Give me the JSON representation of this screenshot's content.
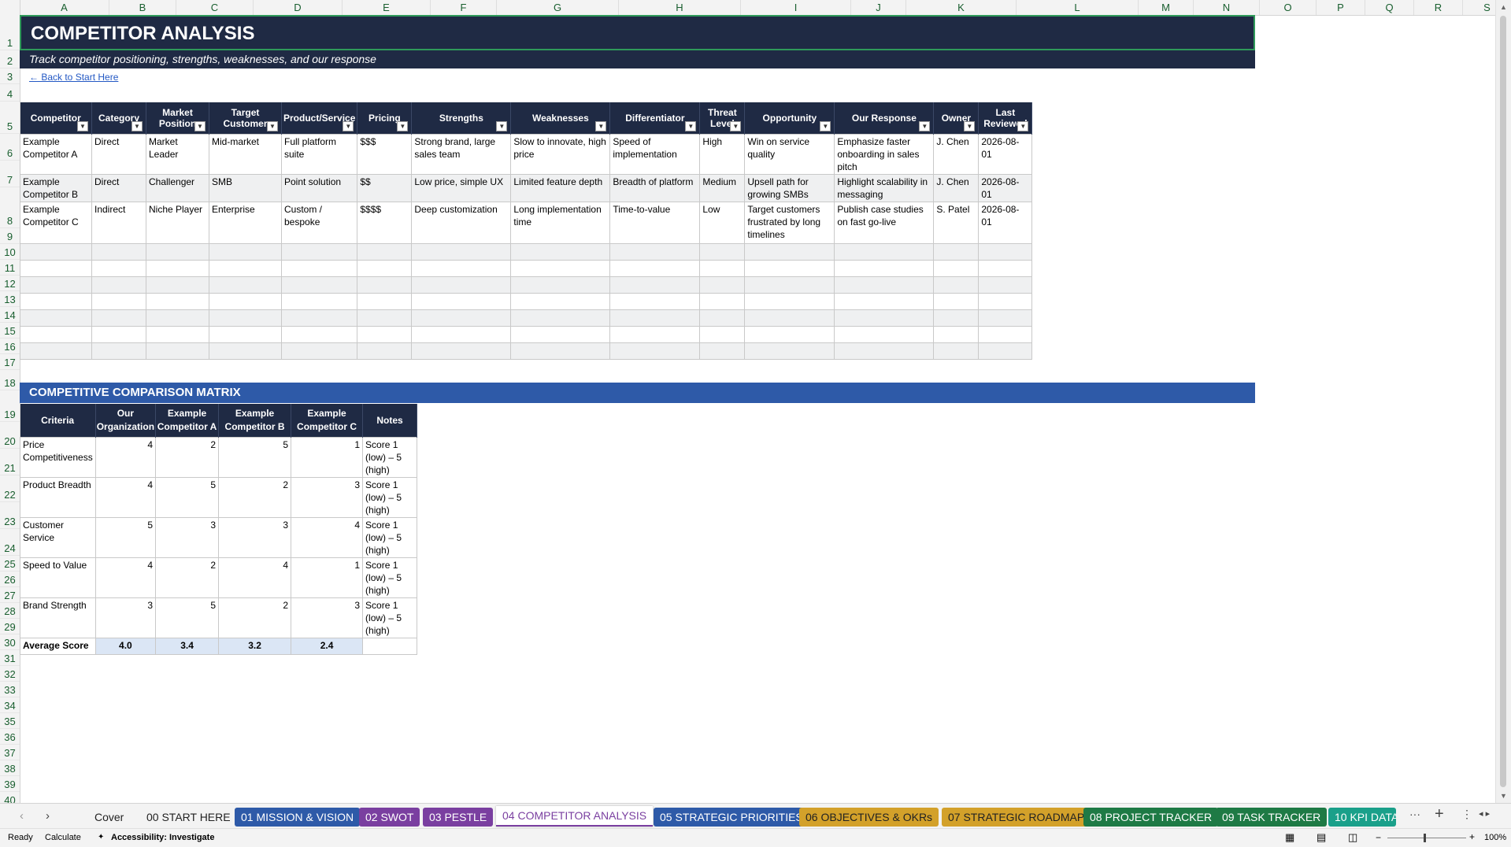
{
  "columns": [
    "A",
    "B",
    "C",
    "D",
    "E",
    "F",
    "G",
    "H",
    "I",
    "J",
    "K",
    "L",
    "M",
    "N",
    "O",
    "P",
    "Q",
    "R",
    "S"
  ],
  "rows": [
    "1",
    "2",
    "3",
    "4",
    "5",
    "6",
    "7",
    "8",
    "9",
    "10",
    "11",
    "12",
    "13",
    "14",
    "15",
    "16",
    "17",
    "18",
    "19",
    "20",
    "21",
    "22",
    "23",
    "24",
    "25",
    "26",
    "27",
    "28",
    "29",
    "30",
    "31",
    "32",
    "33",
    "34",
    "35",
    "36",
    "37",
    "38",
    "39",
    "40"
  ],
  "title": "COMPETITOR ANALYSIS",
  "subtitle": "Track competitor positioning, strengths, weaknesses, and our response",
  "back_link": "← Back to Start Here",
  "competitor_table": {
    "headers": [
      "Competitor",
      "Category",
      "Market Position",
      "Target Customer",
      "Product/Service",
      "Pricing",
      "Strengths",
      "Weaknesses",
      "Differentiator",
      "Threat Level",
      "Opportunity",
      "Our Response",
      "Owner",
      "Last Reviewed"
    ],
    "rows": [
      [
        "Example Competitor A",
        "Direct",
        "Market Leader",
        "Mid-market",
        "Full platform suite",
        "$$$",
        "Strong brand, large sales team",
        "Slow to innovate, high price",
        "Speed of implementation",
        "High",
        "Win on service quality",
        "Emphasize faster onboarding in sales pitch",
        "J. Chen",
        "2026-08-01"
      ],
      [
        "Example Competitor B",
        "Direct",
        "Challenger",
        "SMB",
        "Point solution",
        "$$",
        "Low price, simple UX",
        "Limited feature depth",
        "Breadth of platform",
        "Medium",
        "Upsell path for growing SMBs",
        "Highlight scalability in messaging",
        "J. Chen",
        "2026-08-01"
      ],
      [
        "Example Competitor C",
        "Indirect",
        "Niche Player",
        "Enterprise",
        "Custom / bespoke",
        "$$$$",
        "Deep customization",
        "Long implementation time",
        "Time-to-value",
        "Low",
        "Target customers frustrated by long timelines",
        "Publish case studies on fast go-live",
        "S. Patel",
        "2026-08-01"
      ]
    ]
  },
  "matrix": {
    "title": "COMPETITIVE COMPARISON MATRIX",
    "headers": [
      "Criteria",
      "Our Organization",
      "Example Competitor A",
      "Example Competitor B",
      "Example Competitor C",
      "Notes"
    ],
    "rows": [
      [
        "Price Competitiveness",
        "4",
        "2",
        "5",
        "1",
        "Score 1 (low) – 5 (high)"
      ],
      [
        "Product Breadth",
        "4",
        "5",
        "2",
        "3",
        "Score 1 (low) – 5 (high)"
      ],
      [
        "Customer Service",
        "5",
        "3",
        "3",
        "4",
        "Score 1 (low) – 5 (high)"
      ],
      [
        "Speed to Value",
        "4",
        "2",
        "4",
        "1",
        "Score 1 (low) – 5 (high)"
      ],
      [
        "Brand Strength",
        "3",
        "5",
        "2",
        "3",
        "Score 1 (low) – 5 (high)"
      ]
    ],
    "average_label": "Average Score",
    "averages": [
      "4.0",
      "3.4",
      "3.2",
      "2.4"
    ]
  },
  "sheet_tabs": [
    {
      "label": "Cover",
      "bg": "",
      "fg": "#222222"
    },
    {
      "label": "00 START HERE",
      "bg": "",
      "fg": "#222222"
    },
    {
      "label": "01 MISSION & VISION",
      "bg": "#2e5aa8",
      "fg": "#ffffff"
    },
    {
      "label": "02 SWOT",
      "bg": "#7a3fa0",
      "fg": "#ffffff"
    },
    {
      "label": "03 PESTLE",
      "bg": "#7a3fa0",
      "fg": "#ffffff"
    },
    {
      "label": "04 COMPETITOR ANALYSIS",
      "bg": "#ffffff",
      "fg": "#7a3fa0",
      "active": true
    },
    {
      "label": "05 STRATEGIC PRIORITIES",
      "bg": "#2e5aa8",
      "fg": "#ffffff"
    },
    {
      "label": "06 OBJECTIVES & OKRs",
      "bg": "#d3a12a",
      "fg": "#222222"
    },
    {
      "label": "07 STRATEGIC ROADMAP",
      "bg": "#d3a12a",
      "fg": "#222222"
    },
    {
      "label": "08 PROJECT TRACKER",
      "bg": "#1e7a45",
      "fg": "#ffffff"
    },
    {
      "label": "09 TASK TRACKER",
      "bg": "#1e7a45",
      "fg": "#ffffff"
    },
    {
      "label": "10 KPI DATA",
      "bg": "#1aa08a",
      "fg": "#ffffff"
    }
  ],
  "status": {
    "ready": "Ready",
    "calculate": "Calculate",
    "accessibility": "Accessibility: Investigate",
    "zoom": "100%"
  }
}
